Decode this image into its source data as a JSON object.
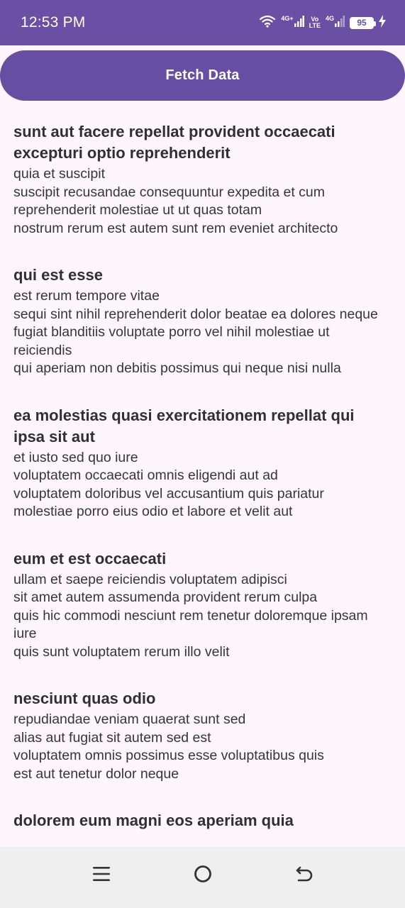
{
  "status_bar": {
    "time": "12:53 PM",
    "signal1_label": "4G+",
    "volte_top": "Vo",
    "volte_bottom": "LTE",
    "signal2_label": "4G",
    "battery": "95"
  },
  "fetch_button": {
    "label": "Fetch Data"
  },
  "posts": [
    {
      "title": "sunt aut facere repellat provident occaecati excepturi optio reprehenderit",
      "body": "quia et suscipit\nsuscipit recusandae consequuntur expedita et cum\nreprehenderit molestiae ut ut quas totam\nnostrum rerum est autem sunt rem eveniet architecto"
    },
    {
      "title": "qui est esse",
      "body": "est rerum tempore vitae\nsequi sint nihil reprehenderit dolor beatae ea dolores neque\nfugiat blanditiis voluptate porro vel nihil molestiae ut reiciendis\nqui aperiam non debitis possimus qui neque nisi nulla"
    },
    {
      "title": "ea molestias quasi exercitationem repellat qui ipsa sit aut",
      "body": "et iusto sed quo iure\nvoluptatem occaecati omnis eligendi aut ad\nvoluptatem doloribus vel accusantium quis pariatur\nmolestiae porro eius odio et labore et velit aut"
    },
    {
      "title": "eum et est occaecati",
      "body": "ullam et saepe reiciendis voluptatem adipisci\nsit amet autem assumenda provident rerum culpa\nquis hic commodi nesciunt rem tenetur doloremque ipsam iure\nquis sunt voluptatem rerum illo velit"
    },
    {
      "title": "nesciunt quas odio",
      "body": "repudiandae veniam quaerat sunt sed\nalias aut fugiat sit autem sed est\nvoluptatem omnis possimus esse voluptatibus quis\nest aut tenetur dolor neque"
    },
    {
      "title": "dolorem eum magni eos aperiam quia",
      "body": ""
    }
  ],
  "nav_bar": {
    "icons": [
      "menu-icon",
      "home-icon",
      "back-icon"
    ]
  },
  "colors": {
    "accent": "#674ea2",
    "status_bar": "#6a4fa4",
    "background": "#fdf7fd",
    "nav_bar": "#efeff0"
  }
}
